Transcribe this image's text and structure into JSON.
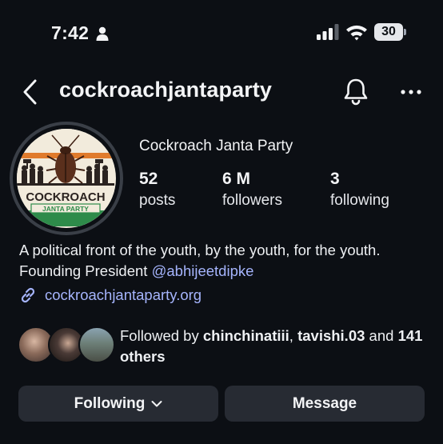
{
  "status_bar": {
    "time": "7:42",
    "battery": "30"
  },
  "header": {
    "username": "cockroachjantaparty"
  },
  "profile": {
    "display_name": "Cockroach Janta Party",
    "avatar_logo": {
      "line1": "COCKROACH",
      "line2": "JANTA PARTY"
    },
    "stats": [
      {
        "value": "52",
        "label": "posts"
      },
      {
        "value": "6 M",
        "label": "followers"
      },
      {
        "value": "3",
        "label": "following"
      }
    ],
    "bio_text": "A political front of the youth, by the youth, for the youth. Founding President ",
    "bio_mention": "@abhijeetdipke",
    "link": "cockroachjantaparty.org"
  },
  "followed_by": {
    "prefix": "Followed by ",
    "user1": "chinchinatiii",
    "separator": ", ",
    "user2": "tavishi.03",
    "conjunction": " and ",
    "others": "141 others"
  },
  "buttons": {
    "following": "Following",
    "message": "Message"
  },
  "icons": [
    "person-icon",
    "signal-icon",
    "wifi-icon",
    "battery-icon",
    "back-icon",
    "bell-icon",
    "more-icon",
    "link-icon",
    "chevron-down-icon"
  ],
  "colors": {
    "background": "#0c0f14",
    "button": "#272b33",
    "link": "#a5b4fc",
    "text": "#f3f4f6"
  }
}
